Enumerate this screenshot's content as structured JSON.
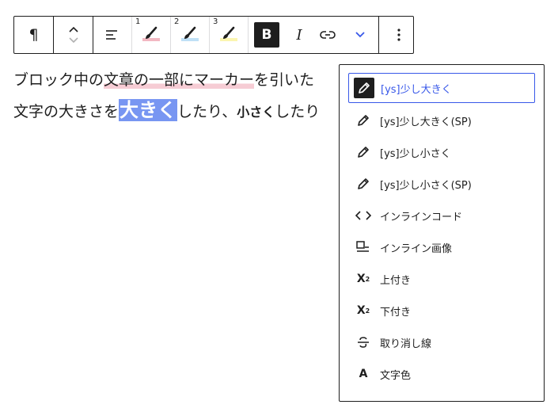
{
  "toolbar": {
    "paragraph_label": "¶",
    "marker_numbers": [
      "1",
      "2",
      "3"
    ],
    "bold_label": "B",
    "italic_label": "I"
  },
  "colors": {
    "marker1": "#f2b8c2",
    "marker2": "#bfe0f6",
    "marker3": "#fbf5b0",
    "highlight": "#7896f2",
    "accent": "#3858e9",
    "text": "#1e1e1e"
  },
  "content": {
    "line1": {
      "p1": "ブロック中の",
      "p2": "文章の一部にマーカー",
      "p3": "を引いた"
    },
    "line2": {
      "p1": "文字の大きさを",
      "p2": "大きく",
      "p3": "したり、",
      "p4": "小さく",
      "p5": "したり"
    }
  },
  "dropdown": {
    "items": [
      {
        "label": "[ys]少し大きく",
        "icon": "pencil-icon",
        "active": true
      },
      {
        "label": "[ys]少し大きく(SP)",
        "icon": "pencil-icon"
      },
      {
        "label": "[ys]少し小さく",
        "icon": "pencil-icon"
      },
      {
        "label": "[ys]少し小さく(SP)",
        "icon": "pencil-icon"
      },
      {
        "label": "インラインコード",
        "icon": "code-icon"
      },
      {
        "label": "インライン画像",
        "icon": "inline-image-icon"
      },
      {
        "label": "上付き",
        "icon": "superscript-icon"
      },
      {
        "label": "下付き",
        "icon": "subscript-icon"
      },
      {
        "label": "取り消し線",
        "icon": "strikethrough-icon"
      },
      {
        "label": "文字色",
        "icon": "text-color-icon"
      }
    ]
  }
}
